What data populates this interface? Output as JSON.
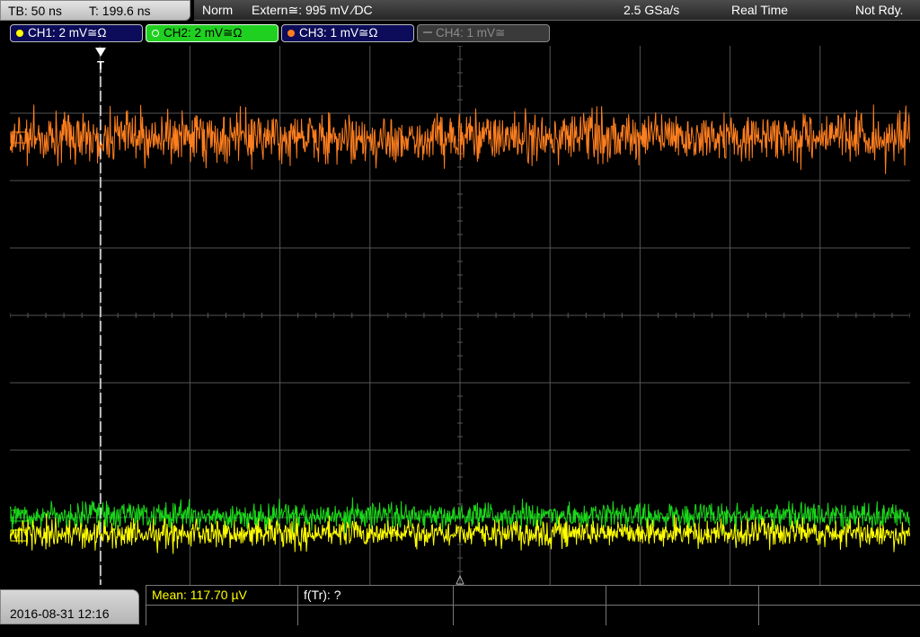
{
  "header": {
    "timebase": "TB: 50 ns",
    "trigger_time": "T: 199.6 ns",
    "acq_mode": "Norm",
    "trigger_source": "Extern≅: 995 mV ∕DC",
    "sample_rate": "2.5 GSa/s",
    "sampling_mode": "Real Time",
    "status": "Not Rdy."
  },
  "channels": [
    {
      "label": "CH1: 2 mV≅Ω",
      "color": "#ffff00",
      "active": true
    },
    {
      "label": "CH2: 2 mV≅Ω",
      "color": "#19d819",
      "active": true
    },
    {
      "label": "CH3: 1 mV≅Ω",
      "color": "#ff7f1f",
      "active": true
    },
    {
      "label": "CH4: 1 mV≅",
      "color": "#777777",
      "active": false
    }
  ],
  "trigger_marker": "T",
  "date_time": "2016-08-31 12:16",
  "measurements": {
    "mean": "Mean: 117.70 µV",
    "freq": "f(Tr): ?"
  },
  "colors": {
    "ch1": "#ffff00",
    "ch2": "#19d819",
    "ch3": "#ff7f1f",
    "grid": "#555555",
    "meas_text": "#ffff00"
  }
}
